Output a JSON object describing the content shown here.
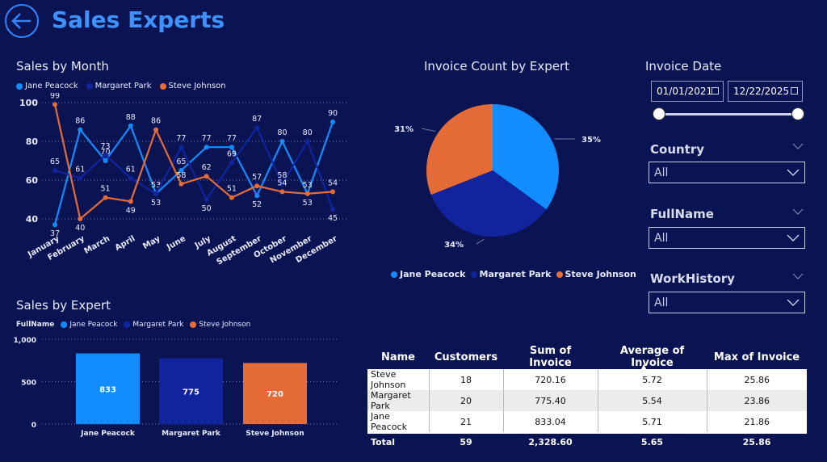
{
  "header": {
    "title": "Sales Experts"
  },
  "colors": {
    "jane": "#118dff",
    "margaret": "#12239e",
    "steve": "#e66c37",
    "bg": "#0b1452"
  },
  "sales_by_month": {
    "title": "Sales by Month",
    "legend": [
      "Jane Peacock",
      "Margaret Park",
      "Steve Johnson"
    ]
  },
  "sales_by_expert": {
    "title": "Sales by Expert",
    "legend_title": "FullName",
    "legend": [
      "Jane Peacock",
      "Margaret Park",
      "Steve Johnson"
    ]
  },
  "pie_chart": {
    "title": "Invoice Count by Expert",
    "legend": [
      "Jane Peacock",
      "Margaret Park",
      "Steve Johnson"
    ]
  },
  "invoice_date": {
    "title": "Invoice Date",
    "start": "01/01/2021",
    "end": "12/22/2025"
  },
  "slicers": [
    {
      "title": "Country",
      "value": "All"
    },
    {
      "title": "FullName",
      "value": "All"
    },
    {
      "title": "WorkHistory",
      "value": "All"
    }
  ],
  "table": {
    "headers": [
      "Name",
      "Customers",
      "Sum of Invoice",
      "Average of Invoice",
      "Max of Invoice"
    ],
    "rows": [
      [
        "Steve Johnson",
        "18",
        "720.16",
        "5.72",
        "25.86"
      ],
      [
        "Margaret Park",
        "20",
        "775.40",
        "5.54",
        "23.86"
      ],
      [
        "Jane Peacock",
        "21",
        "833.04",
        "5.71",
        "21.86"
      ]
    ],
    "total": [
      "Total",
      "59",
      "2,328.60",
      "5.65",
      "25.86"
    ]
  },
  "chart_data": [
    {
      "type": "line",
      "title": "Sales by Month",
      "categories": [
        "January",
        "February",
        "March",
        "April",
        "May",
        "June",
        "July",
        "August",
        "September",
        "October",
        "November",
        "December"
      ],
      "ylim": [
        40,
        100
      ],
      "yticks": [
        40,
        60,
        80,
        100
      ],
      "grid": true,
      "legend_position": "top-left",
      "series": [
        {
          "name": "Jane Peacock",
          "color": "#118dff",
          "values": [
            37,
            86,
            70,
            88,
            53,
            65,
            77,
            77,
            52,
            80,
            53,
            90
          ]
        },
        {
          "name": "Margaret Park",
          "color": "#12239e",
          "values": [
            65,
            61,
            73,
            61,
            53,
            77,
            50,
            69,
            87,
            58,
            80,
            45
          ]
        },
        {
          "name": "Steve Johnson",
          "color": "#e66c37",
          "values": [
            99,
            40,
            51,
            49,
            86,
            58,
            62,
            51,
            57,
            54,
            53,
            54
          ]
        }
      ]
    },
    {
      "type": "bar",
      "title": "Sales by Expert",
      "categories": [
        "Jane Peacock",
        "Margaret Park",
        "Steve Johnson"
      ],
      "values": [
        833,
        775,
        720
      ],
      "labels": [
        "833",
        "775",
        "720"
      ],
      "colors": [
        "#118dff",
        "#12239e",
        "#e66c37"
      ],
      "ylim": [
        0,
        1000
      ],
      "yticks": [
        0,
        500,
        1000
      ],
      "ytick_labels": [
        "0",
        "500",
        "1,000"
      ]
    },
    {
      "type": "pie",
      "title": "Invoice Count by Expert",
      "labels": [
        "Jane Peacock",
        "Margaret Park",
        "Steve Johnson"
      ],
      "values": [
        35,
        34,
        31
      ],
      "value_labels": [
        "35%",
        "34%",
        "31%"
      ],
      "colors": [
        "#118dff",
        "#12239e",
        "#e66c37"
      ]
    }
  ]
}
